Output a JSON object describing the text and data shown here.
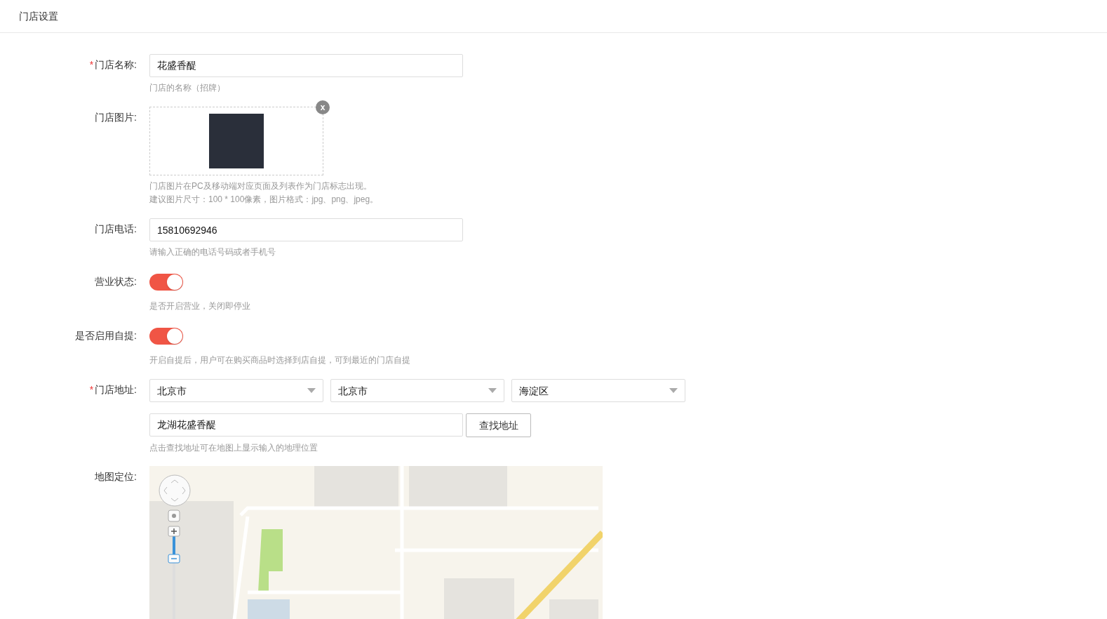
{
  "header": {
    "title": "门店设置"
  },
  "fields": [
    {
      "kind": "text",
      "label": "门店名称:",
      "required": "*",
      "value": "花盛香醍",
      "hints": [
        "门店的名称（招牌）"
      ]
    },
    {
      "kind": "image",
      "label": "门店图片:",
      "remove": "x",
      "hints": [
        "门店图片在PC及移动端对应页面及列表作为门店标志出现。",
        "建议图片尺寸：100 * 100像素，图片格式：jpg、png、jpeg。"
      ]
    },
    {
      "kind": "text",
      "label": "门店电话:",
      "value": "15810692946",
      "hints": [
        "请输入正确的电话号码或者手机号"
      ]
    },
    {
      "kind": "switch",
      "label": "营业状态:",
      "on": true,
      "hints": [
        "是否开启营业，关闭即停业"
      ]
    },
    {
      "kind": "switch",
      "label": "是否启用自提:",
      "on": true,
      "hints": [
        "开启自提后，用户可在购买商品时选择到店自提，可到最近的门店自提"
      ]
    },
    {
      "kind": "address",
      "label": "门店地址:",
      "required": "*",
      "selects": [
        "北京市",
        "北京市",
        "海淀区"
      ],
      "value": "龙湖花盛香醍",
      "button": "查找地址",
      "hints": [
        "点击查找地址可在地图上显示输入的地理位置"
      ]
    },
    {
      "kind": "map",
      "label": "地图定位:"
    }
  ]
}
